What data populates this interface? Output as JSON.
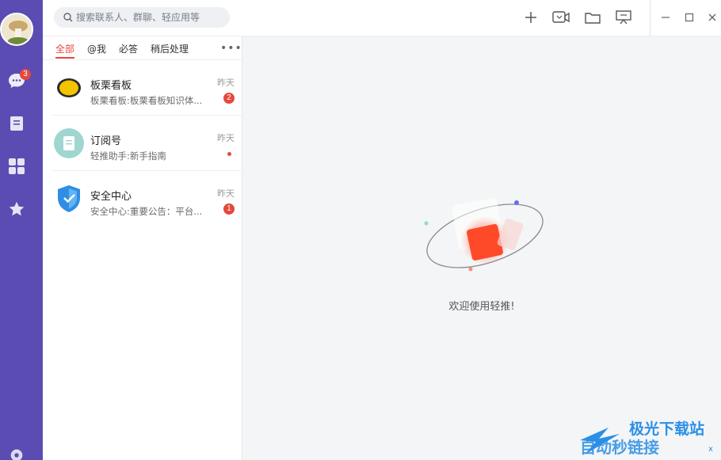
{
  "rail": {
    "items": [
      {
        "name": "chat",
        "icon": "chat-icon",
        "badge": "3"
      },
      {
        "name": "notes",
        "icon": "notebook-icon"
      },
      {
        "name": "apps",
        "icon": "apps-grid-icon"
      },
      {
        "name": "favorites",
        "icon": "star-icon"
      },
      {
        "name": "settings",
        "icon": "gear-icon"
      }
    ],
    "bg_color": "#5b4cb3"
  },
  "search": {
    "placeholder": "搜索联系人、群聊、轻应用等"
  },
  "toolbar": {
    "icons": [
      "plus-icon",
      "video-call-icon",
      "folder-icon",
      "presentation-icon"
    ]
  },
  "window_controls": [
    "minimize-icon",
    "maximize-icon",
    "close-icon"
  ],
  "tabs": [
    {
      "label": "全部",
      "active": true
    },
    {
      "label": "@我"
    },
    {
      "label": "必答"
    },
    {
      "label": "稍后处理"
    }
  ],
  "more_label": "•••",
  "conversations": [
    {
      "name": "板栗看板",
      "preview": "板栗看板:板栗看板知识体...",
      "time": "昨天",
      "unread": "2",
      "avatar_icon": "lemon-icon"
    },
    {
      "name": "订阅号",
      "preview": "轻推助手:新手指南",
      "time": "昨天",
      "unread_dot": true,
      "avatar_icon": "document-icon"
    },
    {
      "name": "安全中心",
      "preview": "安全中心:重要公告：平台...",
      "time": "昨天",
      "unread": "1",
      "avatar_icon": "shield-check-icon"
    }
  ],
  "main": {
    "welcome": "欢迎使用轻推!"
  },
  "watermark": {
    "line1": "极光下载站",
    "line2": "自动秒链接",
    "line3": "x"
  },
  "colors": {
    "accent": "#e5483c",
    "rail": "#5b4cb3",
    "shield": "#2f8de4",
    "teal": "#9fd6d0"
  }
}
